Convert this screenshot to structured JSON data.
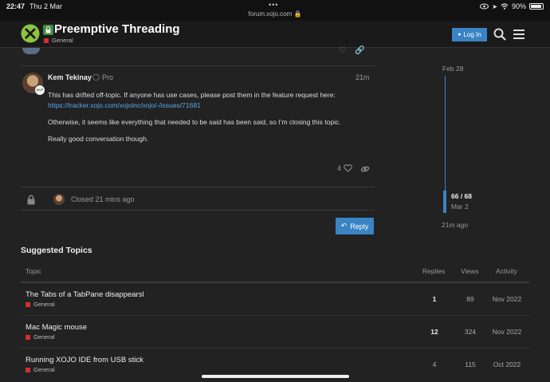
{
  "status_bar": {
    "time": "22:47",
    "date": "Thu 2 Mar",
    "url": "forum.xojo.com",
    "battery": "90%",
    "battery_level": 0.9
  },
  "header": {
    "title": "Preemptive Threading",
    "category": "General",
    "login_label": "Log In",
    "colors": {
      "brand_green": "#3e8e41",
      "accent_blue": "#3a83c4",
      "category_red": "#d32f2f"
    }
  },
  "post": {
    "username": "Kem Tekinay",
    "user_title": "Pro",
    "time": "21m",
    "paragraph1": "This has drifted off-topic. If anyone has use cases, please post them in the feature request here:",
    "link": "https://tracker.xojo.com/xojoinc/xojo/-/issues/71681",
    "paragraph2": "Otherwise, it seems like everything that needed to be said has been said, so I’m closing this topic.",
    "paragraph3": "Really good conversation though.",
    "likes": "4"
  },
  "closed_notice": "Closed 21 mins ago",
  "reply_label": "Reply",
  "timeline": {
    "start_date": "Feb 28",
    "position": "66 / 68",
    "position_date": "Mar 2",
    "last_activity": "21m ago"
  },
  "suggested": {
    "heading": "Suggested Topics",
    "columns": {
      "topic": "Topic",
      "replies": "Replies",
      "views": "Views",
      "activity": "Activity"
    },
    "rows": [
      {
        "title": "The Tabs of a TabPane disappearsl",
        "category": "General",
        "replies": "1",
        "views": "89",
        "activity": "Nov 2022"
      },
      {
        "title": "Mac Magic mouse",
        "category": "General",
        "replies": "12",
        "views": "324",
        "activity": "Nov 2022"
      },
      {
        "title": "Running XOJO IDE from USB stick",
        "category": "General",
        "replies": "4",
        "views": "115",
        "activity": "Oct 2022"
      }
    ]
  }
}
